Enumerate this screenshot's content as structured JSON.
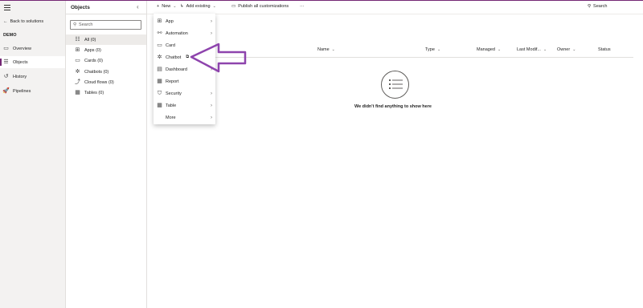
{
  "nav": {
    "back_label": "Back to solutions",
    "solution_name": "DEMO",
    "items": [
      {
        "label": "Overview",
        "icon": "overview-icon"
      },
      {
        "label": "Objects",
        "icon": "objects-icon"
      },
      {
        "label": "History",
        "icon": "history-icon"
      },
      {
        "label": "Pipelines",
        "icon": "pipelines-icon"
      }
    ]
  },
  "objects": {
    "title": "Objects",
    "search_placeholder": "Search",
    "items": [
      {
        "label": "All  (0)"
      },
      {
        "label": "Apps  (0)"
      },
      {
        "label": "Cards  (0)"
      },
      {
        "label": "Chatbots  (0)"
      },
      {
        "label": "Cloud flows  (0)"
      },
      {
        "label": "Tables  (0)"
      }
    ]
  },
  "toolbar": {
    "new_label": "New",
    "add_existing_label": "Add existing",
    "publish_label": "Publish all customizations",
    "more_label": "···",
    "search_label": "Search"
  },
  "table": {
    "columns": [
      "Name",
      "Type",
      "Managed",
      "Last Modif...",
      "Owner",
      "Status"
    ],
    "empty_message": "We didn't find anything to show here"
  },
  "new_menu": {
    "items": [
      {
        "label": "App",
        "submenu": true
      },
      {
        "label": "Automation",
        "submenu": true
      },
      {
        "label": "Card",
        "submenu": false
      },
      {
        "label": "Chatbot",
        "submenu": false
      },
      {
        "label": "Dashboard",
        "submenu": true
      },
      {
        "label": "Report",
        "submenu": false
      },
      {
        "label": "Security",
        "submenu": true
      },
      {
        "label": "Table",
        "submenu": true
      },
      {
        "label": "More",
        "submenu": true
      }
    ]
  },
  "colors": {
    "accent": "#742774",
    "arrow": "#8e44ad"
  }
}
